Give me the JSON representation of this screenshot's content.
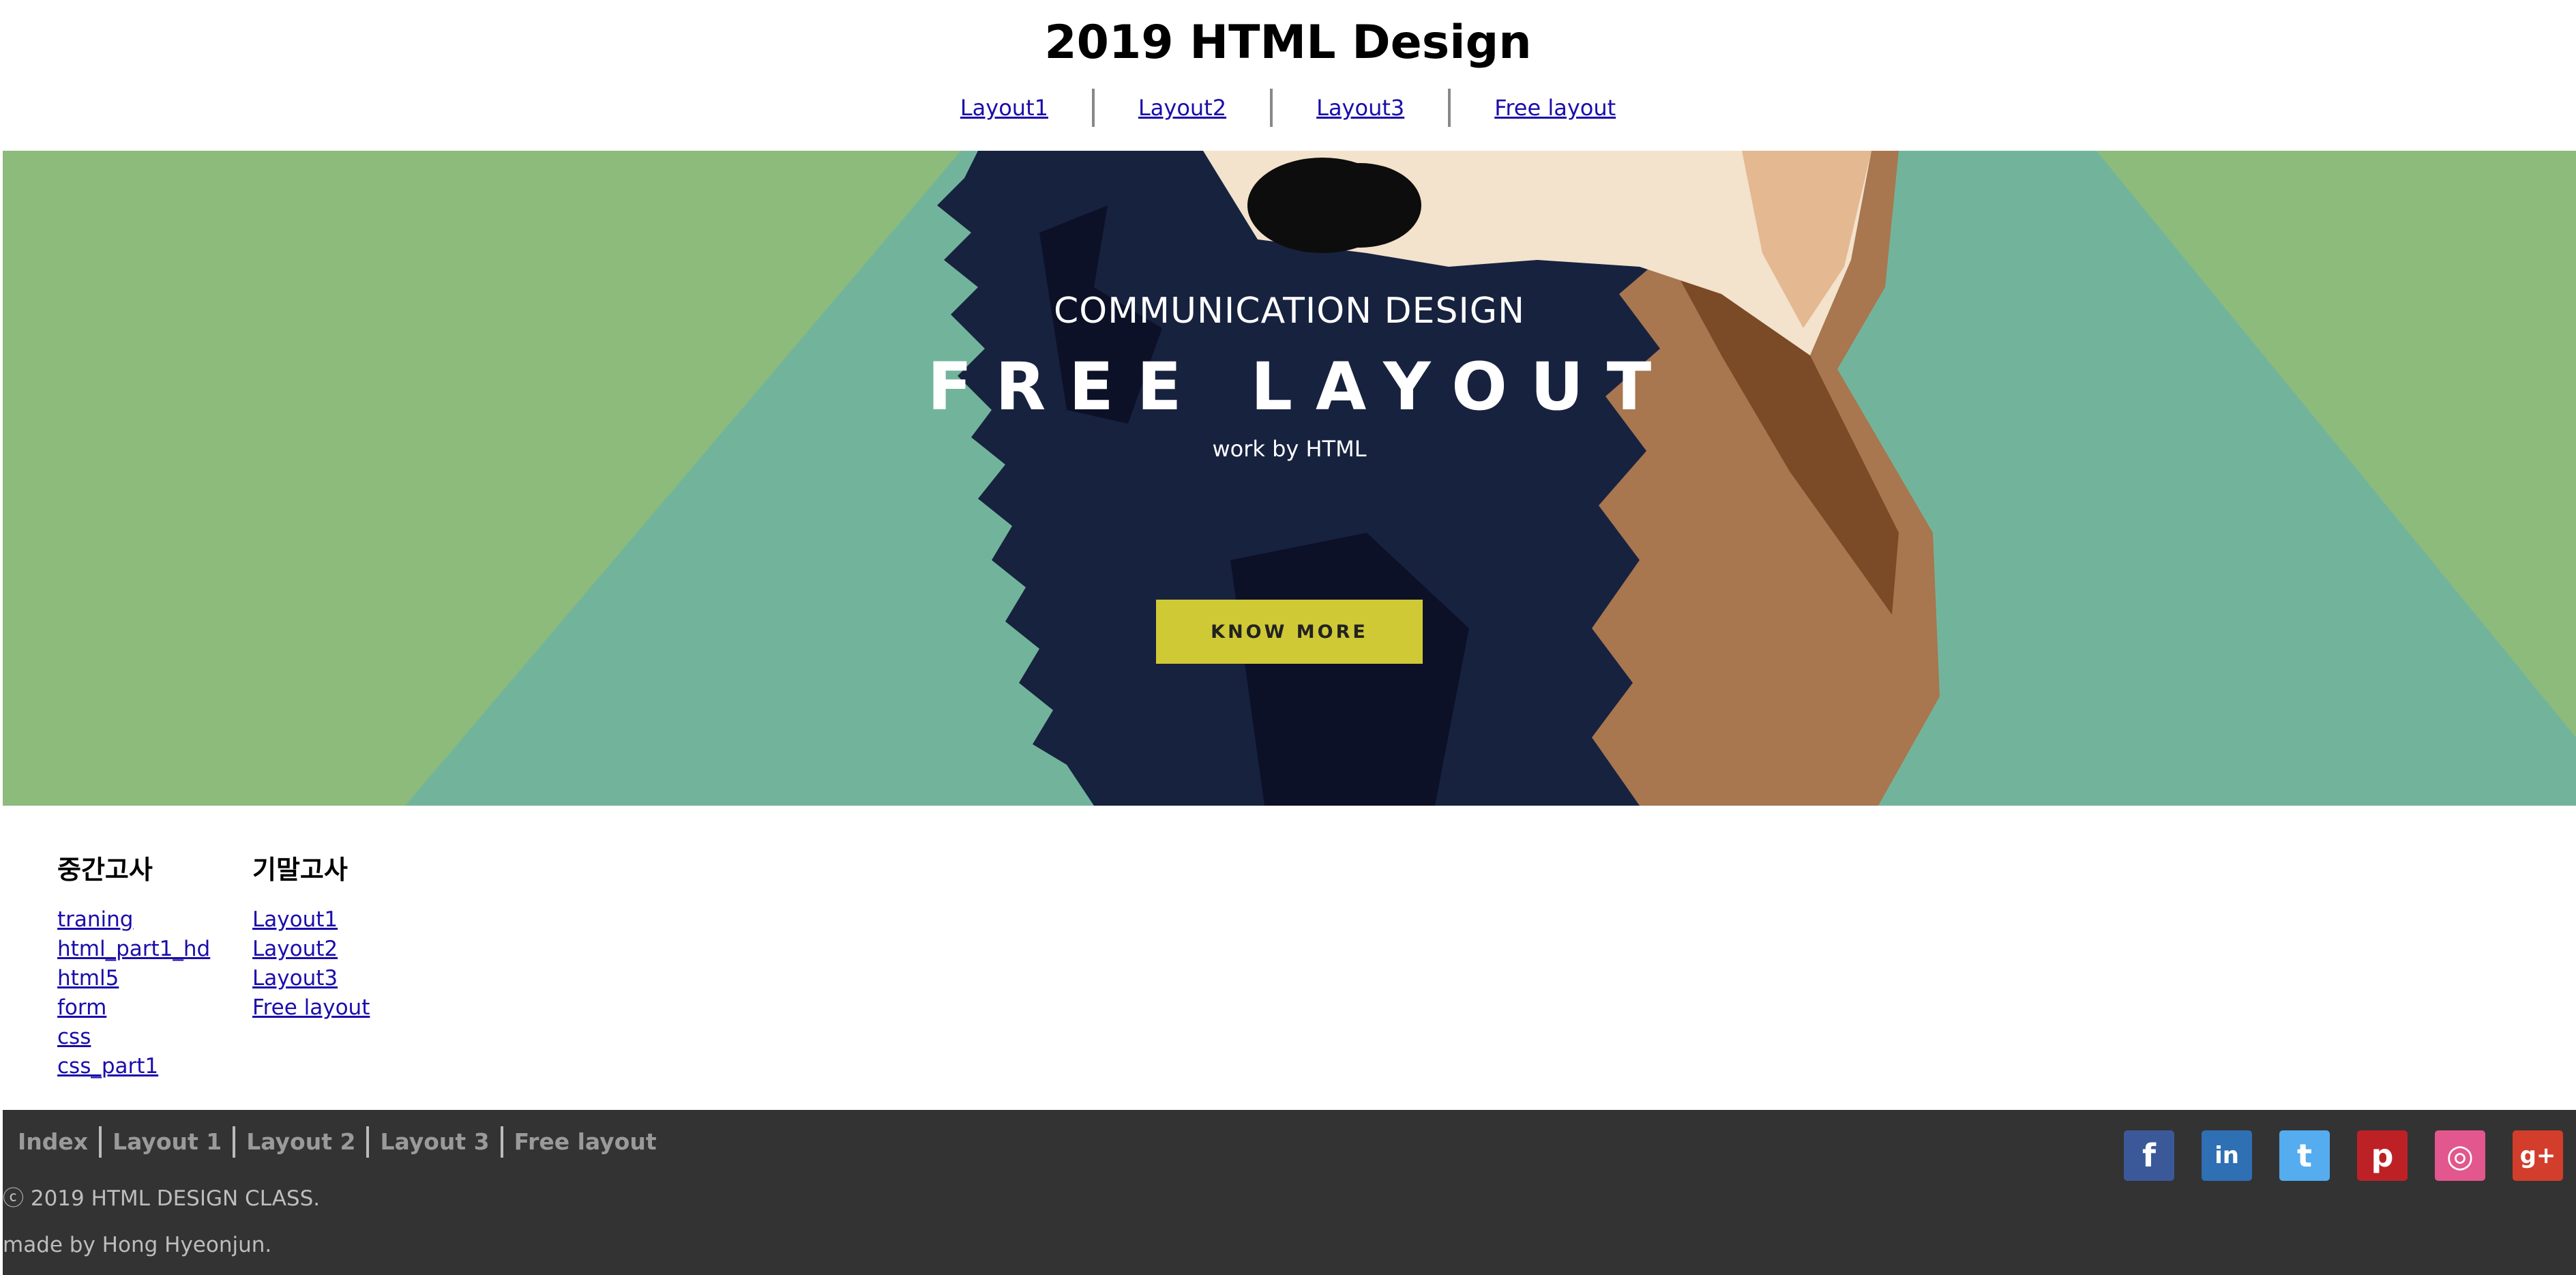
{
  "header": {
    "title": "2019 HTML Design",
    "nav": [
      "Layout1",
      "Layout2",
      "Layout3",
      "Free layout"
    ]
  },
  "hero": {
    "subtitle": "COMMUNICATION DESIGN",
    "title": "FREE LAYOUT",
    "note": "work by HTML",
    "button": "KNOW MORE"
  },
  "content": {
    "midterm": {
      "heading": "중간고사",
      "links": [
        "traning",
        "html_part1_hd",
        "html5",
        "form",
        "css",
        "css_part1"
      ]
    },
    "final": {
      "heading": "기말고사",
      "links": [
        "Layout1",
        "Layout2",
        "Layout3",
        "Free layout"
      ]
    }
  },
  "footer": {
    "nav": [
      "Index",
      "Layout 1",
      "Layout 2",
      "Layout 3",
      "Free layout"
    ],
    "copyright": "ⓒ 2019 HTML DESIGN CLASS.",
    "credit": "made by Hong Hyeonjun.",
    "social": [
      {
        "name": "facebook-icon",
        "glyph": "f",
        "color": "#3b5998"
      },
      {
        "name": "linkedin-icon",
        "glyph": "in",
        "color": "#2f6fb3"
      },
      {
        "name": "twitter-icon",
        "glyph": "t",
        "color": "#55acee"
      },
      {
        "name": "pinterest-icon",
        "glyph": "p",
        "color": "#bd2126"
      },
      {
        "name": "dribbble-icon",
        "glyph": "◎",
        "color": "#e2578d"
      },
      {
        "name": "googleplus-icon",
        "glyph": "g+",
        "color": "#d23e2b"
      }
    ]
  },
  "colors": {
    "hero_green": "#8dbb7b",
    "hero_teal": "#72b49b",
    "hero_navy": "#17223f",
    "button": "#cfc935",
    "footer_bg": "#333333",
    "link": "#1a0dab"
  }
}
